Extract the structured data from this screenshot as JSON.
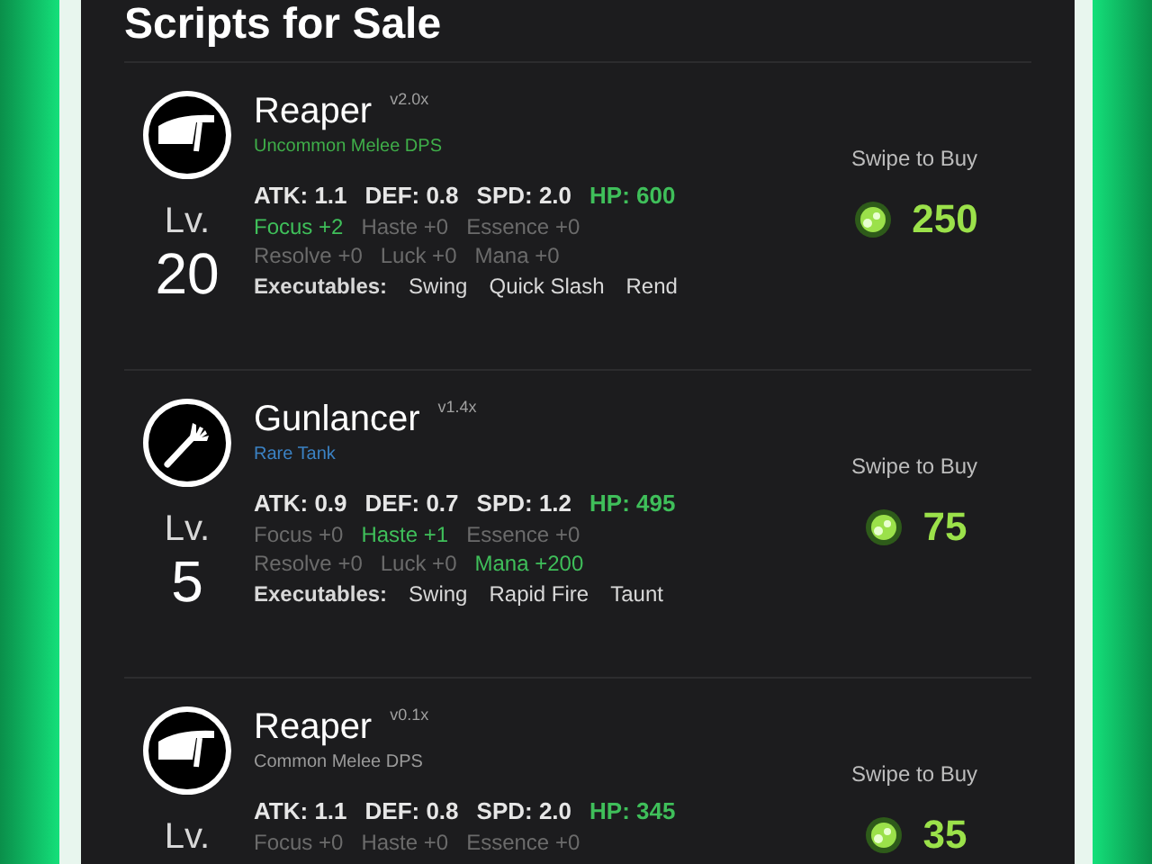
{
  "title": "Scripts for Sale",
  "scripts": [
    {
      "name": "Reaper",
      "version": "v2.0x",
      "rarity": "Uncommon Melee DPS",
      "color": "#3fae49",
      "kind": "blade",
      "level_label": "Lv.",
      "level": "20",
      "main_stats": [
        {
          "text": "ATK: 1.1",
          "boosted": false
        },
        {
          "text": "DEF: 0.8",
          "boosted": false
        },
        {
          "text": "SPD: 2.0",
          "boosted": false
        },
        {
          "text": "HP: 600",
          "boosted": true
        }
      ],
      "bonus_rows": [
        [
          {
            "text": "Focus +2",
            "boosted": true
          },
          {
            "text": "Haste +0",
            "boosted": false
          },
          {
            "text": "Essence +0",
            "boosted": false
          }
        ],
        [
          {
            "text": "Resolve +0",
            "boosted": false
          },
          {
            "text": "Luck +0",
            "boosted": false
          },
          {
            "text": "Mana +0",
            "boosted": false
          }
        ]
      ],
      "executables_label": "Executables:",
      "executables": [
        "Swing",
        "Quick Slash",
        "Rend"
      ],
      "buy_label": "Swipe to Buy",
      "price": "250"
    },
    {
      "name": "Gunlancer",
      "version": "v1.4x",
      "rarity": "Rare Tank",
      "color": "#3b82c4",
      "kind": "fork",
      "level_label": "Lv.",
      "level": "5",
      "main_stats": [
        {
          "text": "ATK: 0.9",
          "boosted": false
        },
        {
          "text": "DEF: 0.7",
          "boosted": false
        },
        {
          "text": "SPD: 1.2",
          "boosted": false
        },
        {
          "text": "HP: 495",
          "boosted": true
        }
      ],
      "bonus_rows": [
        [
          {
            "text": "Focus +0",
            "boosted": false
          },
          {
            "text": "Haste +1",
            "boosted": true
          },
          {
            "text": "Essence +0",
            "boosted": false
          }
        ],
        [
          {
            "text": "Resolve +0",
            "boosted": false
          },
          {
            "text": "Luck +0",
            "boosted": false
          },
          {
            "text": "Mana +200",
            "boosted": true
          }
        ]
      ],
      "executables_label": "Executables:",
      "executables": [
        "Swing",
        "Rapid Fire",
        "Taunt"
      ],
      "buy_label": "Swipe to Buy",
      "price": "75"
    },
    {
      "name": "Reaper",
      "version": "v0.1x",
      "rarity": "Common Melee DPS",
      "color": "#9a9a9a",
      "kind": "blade",
      "level_label": "Lv.",
      "main_stats": [
        {
          "text": "ATK: 1.1",
          "boosted": false
        },
        {
          "text": "DEF: 0.8",
          "boosted": false
        },
        {
          "text": "SPD: 2.0",
          "boosted": false
        },
        {
          "text": "HP: 345",
          "boosted": true
        }
      ],
      "bonus_rows": [
        [
          {
            "text": "Focus +0",
            "boosted": false
          },
          {
            "text": "Haste +0",
            "boosted": false
          },
          {
            "text": "Essence +0",
            "boosted": false
          }
        ]
      ],
      "buy_label": "Swipe to Buy",
      "price": "35"
    }
  ]
}
